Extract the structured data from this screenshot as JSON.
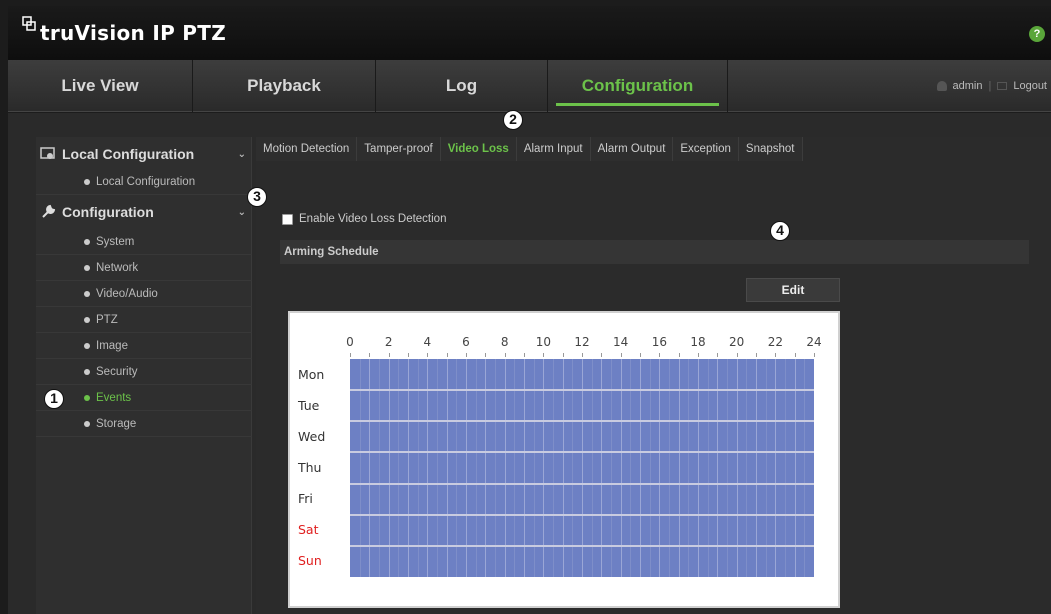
{
  "app": {
    "title": "truVision IP PTZ"
  },
  "nav": {
    "tabs": [
      {
        "label": "Live View"
      },
      {
        "label": "Playback"
      },
      {
        "label": "Log"
      },
      {
        "label": "Configuration"
      }
    ],
    "user": "admin",
    "logout": "Logout"
  },
  "sidebar": {
    "groups": [
      {
        "label": "Local Configuration",
        "items": [
          "Local Configuration"
        ]
      },
      {
        "label": "Configuration",
        "items": [
          "System",
          "Network",
          "Video/Audio",
          "PTZ",
          "Image",
          "Security",
          "Events",
          "Storage"
        ]
      }
    ],
    "active_item": "Events"
  },
  "subtabs": [
    "Motion Detection",
    "Tamper-proof",
    "Video Loss",
    "Alarm Input",
    "Alarm Output",
    "Exception",
    "Snapshot"
  ],
  "active_subtab": "Video Loss",
  "enable_label": "Enable Video Loss Detection",
  "arming_schedule_label": "Arming Schedule",
  "edit_label": "Edit",
  "schedule": {
    "hours": [
      "0",
      "2",
      "4",
      "6",
      "8",
      "10",
      "12",
      "14",
      "16",
      "18",
      "20",
      "22",
      "24"
    ],
    "days": [
      "Mon",
      "Tue",
      "Wed",
      "Thu",
      "Fri",
      "Sat",
      "Sun"
    ],
    "weekend_color": "#e02020",
    "fill_color": "#6d80c4"
  },
  "callouts": [
    "1",
    "2",
    "3",
    "4"
  ],
  "colors": {
    "accent": "#6cc24a",
    "help": "#5aa63a"
  },
  "icons": {
    "help": "?"
  }
}
